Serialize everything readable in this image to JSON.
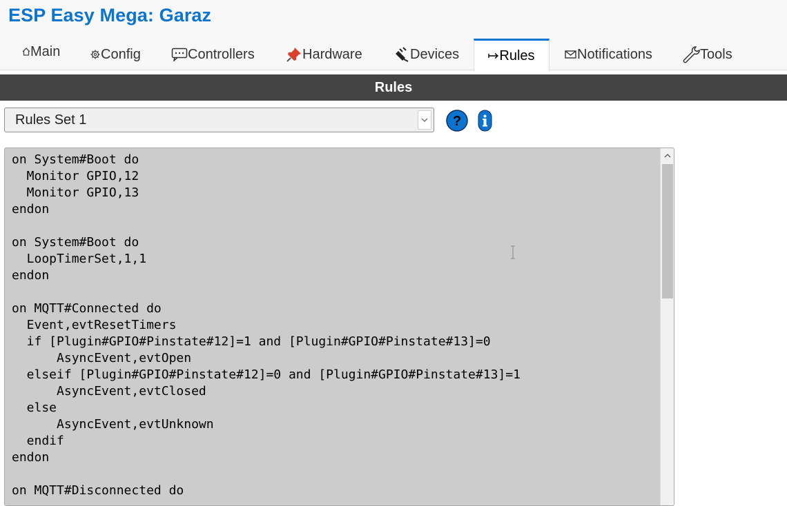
{
  "app": {
    "title": "ESP Easy Mega: Garaz"
  },
  "tabs": [
    {
      "label": "Main",
      "icon": "home-icon"
    },
    {
      "label": "Config",
      "icon": "gear-icon"
    },
    {
      "label": "Controllers",
      "icon": "speech-bubble-icon"
    },
    {
      "label": "Hardware",
      "icon": "pushpin-icon"
    },
    {
      "label": "Devices",
      "icon": "plug-icon"
    },
    {
      "label": "Rules",
      "icon": "arrow-icon",
      "active": true
    },
    {
      "label": "Notifications",
      "icon": "envelope-icon"
    },
    {
      "label": "Tools",
      "icon": "wrench-icon"
    }
  ],
  "section": {
    "title": "Rules"
  },
  "rules_select": {
    "value": "Rules Set 1"
  },
  "editor": {
    "lines": [
      "on System#Boot do",
      "  Monitor GPIO,12",
      "  Monitor GPIO,13",
      "endon",
      "",
      "on System#Boot do",
      "  LoopTimerSet,1,1",
      "endon",
      "",
      "on MQTT#Connected do",
      "  Event,evtResetTimers",
      "  if [Plugin#GPIO#Pinstate#12]=1 and [Plugin#GPIO#Pinstate#13]=0",
      "      AsyncEvent,evtOpen",
      "  elseif [Plugin#GPIO#Pinstate#12]=0 and [Plugin#GPIO#Pinstate#13]=1",
      "      AsyncEvent,evtClosed",
      "  else",
      "      AsyncEvent,evtUnknown",
      "  endif",
      "endon",
      "",
      "on MQTT#Disconnected do"
    ]
  },
  "colors": {
    "accent": "#0b74d1",
    "section_bar": "#444444",
    "editor_bg": "#cccccc",
    "help_icon": "#0b74d1"
  }
}
